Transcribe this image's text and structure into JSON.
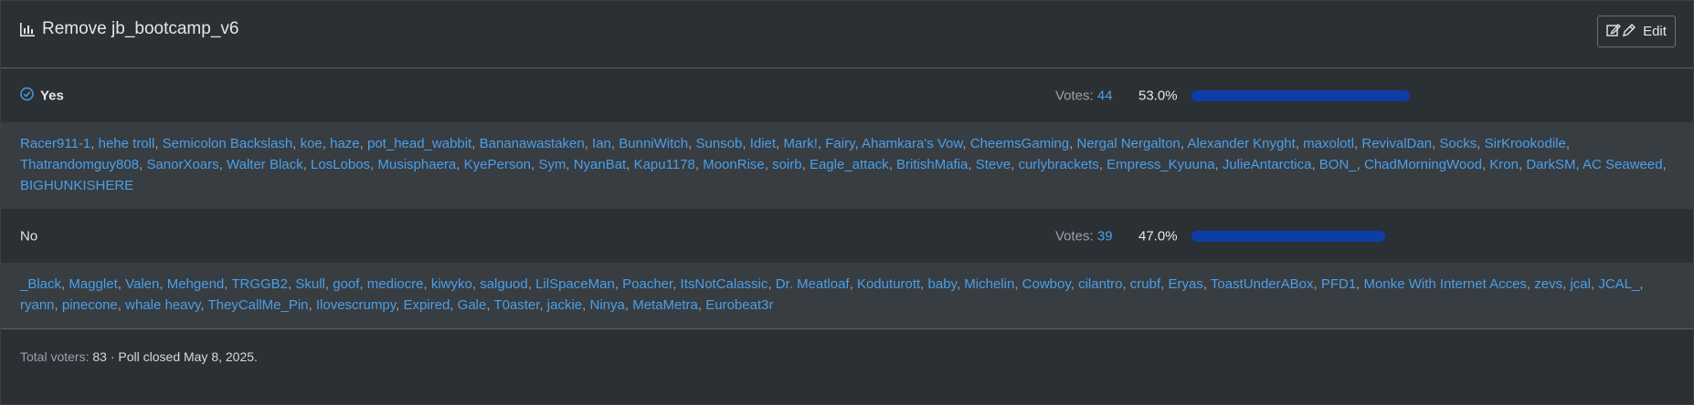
{
  "poll": {
    "title": "Remove jb_bootcamp_v6",
    "edit_label": "Edit",
    "votes_prefix": "Votes: ",
    "options": [
      {
        "label": "Yes",
        "votes": "44",
        "percent": "53.0%",
        "fraction": 0.53,
        "voted": true,
        "voters": [
          "Racer911-1",
          "hehe troll",
          "Semicolon Backslash",
          "koe",
          "haze",
          "pot_head_wabbit",
          "Bananawastaken",
          "Ian",
          "BunniWitch",
          "Sunsob",
          "Idiet",
          "Mark!",
          "Fairy",
          "Ahamkara's Vow",
          "CheemsGaming",
          "Nergal Nergalton",
          "Alexander Knyght",
          "maxolotl",
          "RevivalDan",
          "Socks",
          "SirKrookodile",
          "Thatrandomguy808",
          "SanorXoars",
          "Walter Black",
          "LosLobos",
          "Musisphaera",
          "KyePerson",
          "Sym",
          "NyanBat",
          "Kapu1178",
          "MoonRise",
          "soirb",
          "Eagle_attack",
          "BritishMafia",
          "Steve",
          "curlybrackets",
          "Empress_Kyuuna",
          "JulieAntarctica",
          "BON_",
          "ChadMorningWood",
          "Kron",
          "DarkSM",
          "AC Seaweed",
          "BIGHUNKISHERE"
        ]
      },
      {
        "label": "No",
        "votes": "39",
        "percent": "47.0%",
        "fraction": 0.47,
        "voted": false,
        "voters": [
          "_Black",
          "Magglet",
          "Valen",
          "Mehgend",
          "TRGGB2",
          "Skull",
          "goof",
          "mediocre",
          "kiwyko",
          "salguod",
          "LilSpaceMan",
          "Poacher",
          "ItsNotCalassic",
          "Dr. Meatloaf",
          "Koduturott",
          "baby",
          "Michelin",
          "Cowboy",
          "cilantro",
          "crubf",
          "Eryas",
          "ToastUnderABox",
          "PFD1",
          "Monke With Internet Acces",
          "zevs",
          "jcal",
          "JCAL_",
          "ryann",
          "pinecone",
          "whale heavy",
          "TheyCallMe_Pin",
          "Ilovescrumpy",
          "Expired",
          "Gale",
          "T0aster",
          "jackie",
          "Ninya",
          "MetaMetra",
          "Eurobeat3r"
        ]
      }
    ],
    "footer": {
      "total_label": "Total voters:",
      "total_value": "83",
      "closed_text": "· Poll closed May 8, 2025."
    },
    "colors": {
      "accent": "#4a9fe8",
      "bar": "#0d3ea8"
    },
    "icons": {
      "title": "bar-chart-icon",
      "edit": "edit-icon",
      "voted": "check-circle-icon"
    }
  }
}
